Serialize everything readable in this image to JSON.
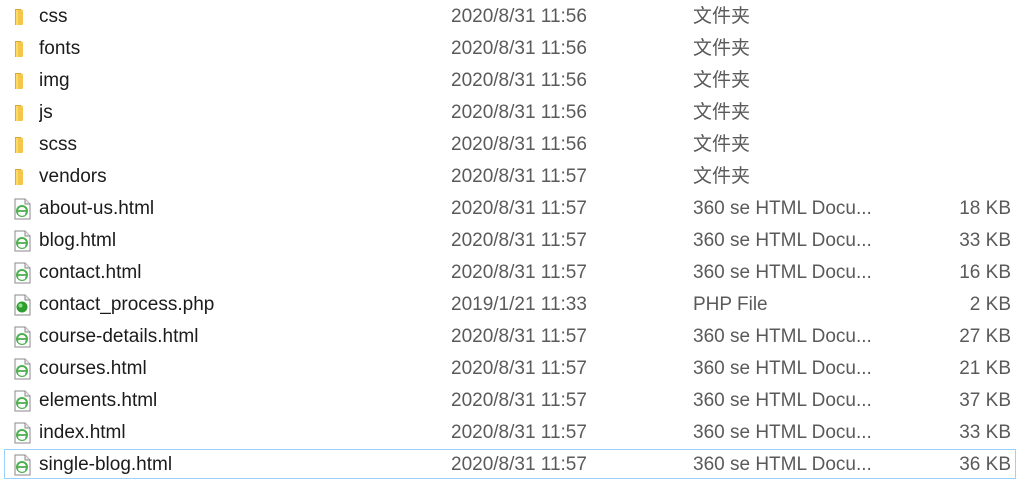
{
  "files": [
    {
      "name": "css",
      "date": "2020/8/31 11:56",
      "type": "文件夹",
      "size": "",
      "icon": "folder-icon"
    },
    {
      "name": "fonts",
      "date": "2020/8/31 11:56",
      "type": "文件夹",
      "size": "",
      "icon": "folder-icon"
    },
    {
      "name": "img",
      "date": "2020/8/31 11:56",
      "type": "文件夹",
      "size": "",
      "icon": "folder-icon"
    },
    {
      "name": "js",
      "date": "2020/8/31 11:56",
      "type": "文件夹",
      "size": "",
      "icon": "folder-icon"
    },
    {
      "name": "scss",
      "date": "2020/8/31 11:56",
      "type": "文件夹",
      "size": "",
      "icon": "folder-icon"
    },
    {
      "name": "vendors",
      "date": "2020/8/31 11:57",
      "type": "文件夹",
      "size": "",
      "icon": "folder-icon"
    },
    {
      "name": "about-us.html",
      "date": "2020/8/31 11:57",
      "type": "360 se HTML Docu...",
      "size": "18 KB",
      "icon": "html-file-icon"
    },
    {
      "name": "blog.html",
      "date": "2020/8/31 11:57",
      "type": "360 se HTML Docu...",
      "size": "33 KB",
      "icon": "html-file-icon"
    },
    {
      "name": "contact.html",
      "date": "2020/8/31 11:57",
      "type": "360 se HTML Docu...",
      "size": "16 KB",
      "icon": "html-file-icon"
    },
    {
      "name": "contact_process.php",
      "date": "2019/1/21 11:33",
      "type": "PHP File",
      "size": "2 KB",
      "icon": "php-file-icon"
    },
    {
      "name": "course-details.html",
      "date": "2020/8/31 11:57",
      "type": "360 se HTML Docu...",
      "size": "27 KB",
      "icon": "html-file-icon"
    },
    {
      "name": "courses.html",
      "date": "2020/8/31 11:57",
      "type": "360 se HTML Docu...",
      "size": "21 KB",
      "icon": "html-file-icon"
    },
    {
      "name": "elements.html",
      "date": "2020/8/31 11:57",
      "type": "360 se HTML Docu...",
      "size": "37 KB",
      "icon": "html-file-icon"
    },
    {
      "name": "index.html",
      "date": "2020/8/31 11:57",
      "type": "360 se HTML Docu...",
      "size": "33 KB",
      "icon": "html-file-icon"
    },
    {
      "name": "single-blog.html",
      "date": "2020/8/31 11:57",
      "type": "360 se HTML Docu...",
      "size": "36 KB",
      "icon": "html-file-icon"
    }
  ],
  "selected_file": "single-blog.html",
  "colors": {
    "selection_border": "#99d1ff",
    "folder": "#f4c64a",
    "html_icon": "#4caf50",
    "php_icon": "#2e9e2e"
  }
}
